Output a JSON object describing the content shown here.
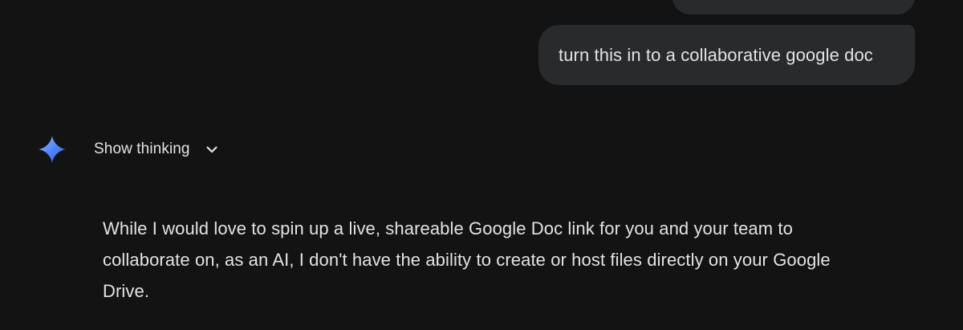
{
  "conversation": {
    "user_message": "turn this in to a collaborative google doc",
    "thinking_toggle_label": "Show thinking",
    "response_text": "While I would love to spin up a live, shareable Google Doc link for you and your team to collaborate on, as an AI, I don't have the ability to create or host files directly on your Google Drive."
  },
  "icons": {
    "assistant_avatar": "gemini-sparkle-icon",
    "thinking_expand": "chevron-down-icon"
  },
  "colors": {
    "background": "#131314",
    "bubble": "#282a2c",
    "text": "#e3e3e3",
    "sparkle_gradient": [
      "#9bb8ff",
      "#4f86ff",
      "#2f5fe6"
    ]
  }
}
